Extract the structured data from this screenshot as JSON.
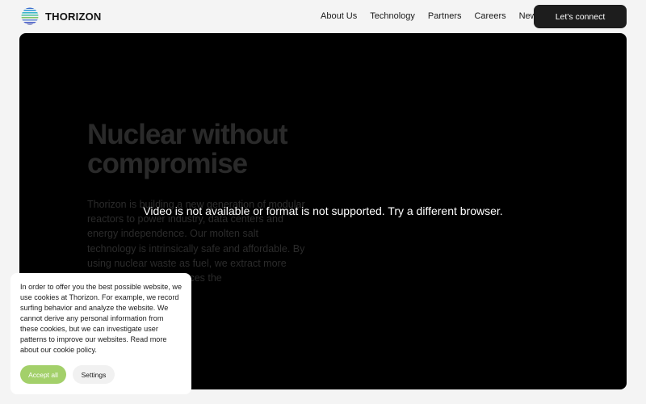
{
  "brand": {
    "name": "THORIZON",
    "logo_icon": "striped-globe-icon"
  },
  "nav": {
    "items": [
      {
        "label": "About Us"
      },
      {
        "label": "Technology"
      },
      {
        "label": "Partners"
      },
      {
        "label": "Careers"
      },
      {
        "label": "News"
      }
    ],
    "cta_label": "Let's connect"
  },
  "hero": {
    "title": "Nuclear without compromise",
    "body": "Thorizon is building a new generation of modular reactors to power industry, data centers and energy independence. Our molten salt technology is intrinsically safe and affordable. By using nuclear waste as fuel, we extract more energy from the resources the",
    "video_message": "Video is not available or format is not supported. Try a different browser."
  },
  "cookie_banner": {
    "text": "In order to offer you the best possible website, we use cookies at Thorizon. For example, we record surfing behavior and analyze the website. We cannot derive any personal information from these cookies, but we can investigate user patterns to improve our websites. Read more about our cookie policy.",
    "accept_label": "Accept all",
    "settings_label": "Settings",
    "accept_color": "#a3d06a"
  },
  "colors": {
    "background": "#f4f4f4",
    "hero_background": "#000000",
    "cta_background": "#1d1d1d"
  }
}
